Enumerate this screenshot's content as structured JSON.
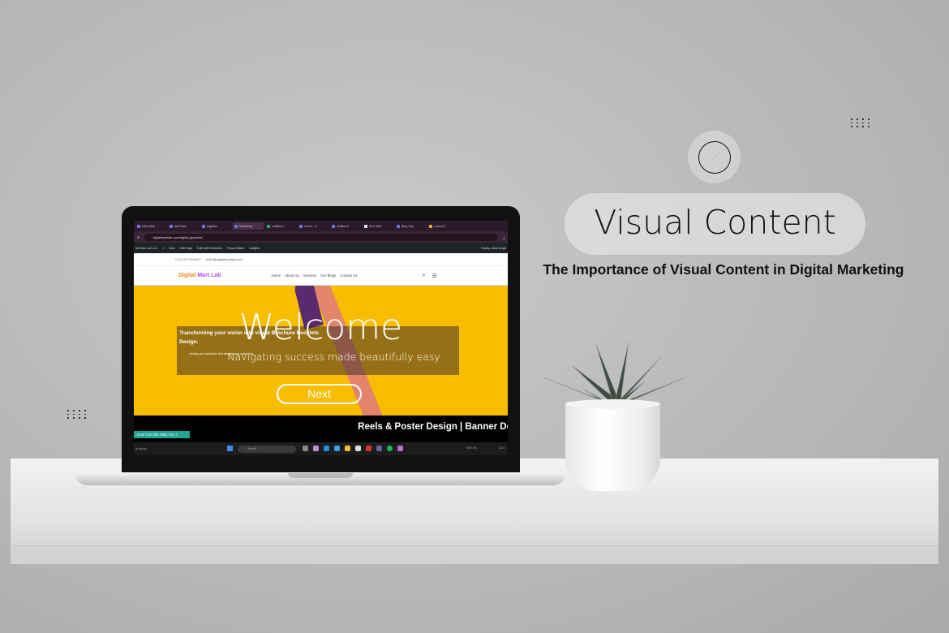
{
  "banner": {
    "title": "Visual Content",
    "subtitle": "The Importance of Visual Content in Digital Marketing",
    "icon": "compass-icon"
  },
  "browser": {
    "tabs": [
      "(46) What",
      "Add New",
      "Digitalm",
      "Marketing",
      "Untitled s",
      "Home – C",
      "Untitled d",
      "AI in Web",
      "Blog Topi",
      "How to C"
    ],
    "active_tab": 3,
    "url": "digitalmartlab.com/digital-graphics/"
  },
  "wp_admin": {
    "site": "ital Mart Lab LLC",
    "comments": "1",
    "new": "New",
    "edit_page": "Edit Page",
    "elementor": "Edit with Elementor",
    "popup": "Popup Maker",
    "insights": "Insights",
    "howdy": "Howdy, victor singh"
  },
  "site": {
    "phone": "+1 (717) 710-9577",
    "email": "hello@digitalmartlab.com",
    "logo": {
      "part1": "Digital ",
      "part2": "Mart Lab"
    },
    "nav": [
      "Home",
      "About Us",
      "Services",
      "Our Blogs",
      "Contact Us"
    ],
    "hero": {
      "welcome": "Welcome",
      "tagline": "Navigating success made beautifully easy",
      "next": "Next",
      "behind_title": "Transforming your vision into visual Brochure Booklets Design.",
      "behind_text": "Leaving an impression that attracts your customers.",
      "bg_color": "#f8bd00"
    },
    "marquee": "Reels & Poster Design | Banner De",
    "help": "How Can We Help You ?"
  },
  "taskbar": {
    "weather": "ly cloudy",
    "search": "Search",
    "lang": "ENG IN",
    "time": "22-0"
  }
}
